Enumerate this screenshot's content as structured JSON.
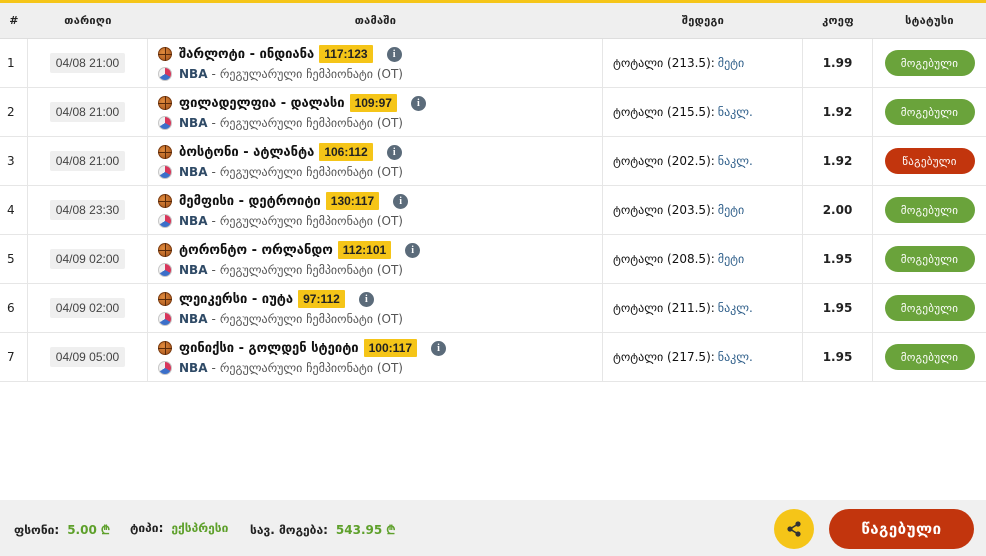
{
  "header": {
    "num": "#",
    "date": "თარიღი",
    "game": "თამაში",
    "result": "შედეგი",
    "odds": "კოეფ",
    "status": "სტატუსი"
  },
  "rows": [
    {
      "num": "1",
      "date": "04/08 21:00",
      "teams": "შარლოტი - ინდიანა",
      "score": "117:123",
      "league": "NBA",
      "league_desc": "რეგულარული ჩემპიონატი (OT)",
      "result_label": "ტოტალი (213.5):",
      "pick": "მეტი",
      "odds": "1.99",
      "status": "მოგებული",
      "status_type": "won"
    },
    {
      "num": "2",
      "date": "04/08 21:00",
      "teams": "ფილადელფია - დალასი",
      "score": "109:97",
      "league": "NBA",
      "league_desc": "რეგულარული ჩემპიონატი (OT)",
      "result_label": "ტოტალი (215.5):",
      "pick": "ნაკლ.",
      "odds": "1.92",
      "status": "მოგებული",
      "status_type": "won"
    },
    {
      "num": "3",
      "date": "04/08 21:00",
      "teams": "ბოსტონი - ატლანტა",
      "score": "106:112",
      "league": "NBA",
      "league_desc": "რეგულარული ჩემპიონატი (OT)",
      "result_label": "ტოტალი (202.5):",
      "pick": "ნაკლ.",
      "odds": "1.92",
      "status": "წაგებული",
      "status_type": "lost"
    },
    {
      "num": "4",
      "date": "04/08 23:30",
      "teams": "მემფისი - დეტროიტი",
      "score": "130:117",
      "league": "NBA",
      "league_desc": "რეგულარული ჩემპიონატი (OT)",
      "result_label": "ტოტალი (203.5):",
      "pick": "მეტი",
      "odds": "2.00",
      "status": "მოგებული",
      "status_type": "won"
    },
    {
      "num": "5",
      "date": "04/09 02:00",
      "teams": "ტორონტო - ორლანდო",
      "score": "112:101",
      "league": "NBA",
      "league_desc": "რეგულარული ჩემპიონატი (OT)",
      "result_label": "ტოტალი (208.5):",
      "pick": "მეტი",
      "odds": "1.95",
      "status": "მოგებული",
      "status_type": "won"
    },
    {
      "num": "6",
      "date": "04/09 02:00",
      "teams": "ლეიკერსი - იუტა",
      "score": "97:112",
      "league": "NBA",
      "league_desc": "რეგულარული ჩემპიონატი (OT)",
      "result_label": "ტოტალი (211.5):",
      "pick": "ნაკლ.",
      "odds": "1.95",
      "status": "მოგებული",
      "status_type": "won"
    },
    {
      "num": "7",
      "date": "04/09 05:00",
      "teams": "ფინიქსი - გოლდენ სტეიტი",
      "score": "100:117",
      "league": "NBA",
      "league_desc": "რეგულარული ჩემპიონატი (OT)",
      "result_label": "ტოტალი (217.5):",
      "pick": "ნაკლ.",
      "odds": "1.95",
      "status": "მოგებული",
      "status_type": "won"
    }
  ],
  "footer": {
    "stake_label": "ფსონი:",
    "stake_value": "5.00",
    "type_label": "ტიპი:",
    "type_value": "ექსპრესი",
    "potential_label": "სავ. მოგება:",
    "potential_value": "543.95",
    "currency_symbol": "₾",
    "final_status": "წაგებული"
  },
  "icons": {
    "sport": "basketball-icon",
    "league": "nba-icon",
    "info": "info-icon",
    "share": "share-icon"
  },
  "colors": {
    "accent": "#f5c518",
    "won": "#6aa33b",
    "lost": "#c2350d"
  }
}
